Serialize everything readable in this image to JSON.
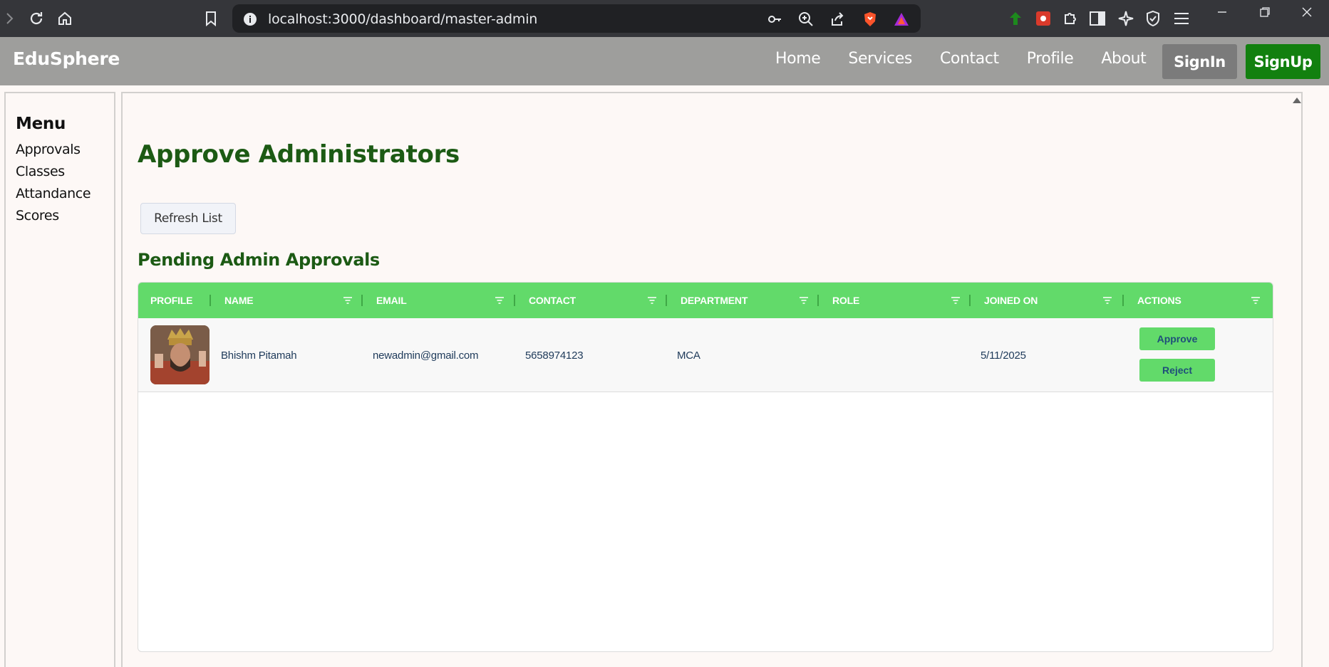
{
  "browser": {
    "url": "localhost:3000/dashboard/master-admin"
  },
  "navbar": {
    "brand": "EduSphere",
    "links": [
      "Home",
      "Services",
      "Contact",
      "Profile",
      "About"
    ],
    "signin_label": "SignIn",
    "signup_label": "SignUp",
    "signup_color": "#12800f"
  },
  "sidebar": {
    "title": "Menu",
    "items": [
      "Approvals",
      "Classes",
      "Attandance",
      "Scores"
    ]
  },
  "main": {
    "title": "Approve Administrators",
    "refresh_label": "Refresh List",
    "section_title": "Pending Admin Approvals",
    "accent_color": "#1c5a14",
    "header_color": "#62da6a",
    "columns": [
      "PROFILE",
      "NAME",
      "EMAIL",
      "CONTACT",
      "DEPARTMENT",
      "ROLE",
      "JOINED ON",
      "ACTIONS"
    ],
    "rows": [
      {
        "name": "Bhishm Pitamah",
        "email": "newadmin@gmail.com",
        "contact": "5658974123",
        "department": "MCA",
        "role": "",
        "joined_on": "5/11/2025",
        "approve_label": "Approve",
        "reject_label": "Reject"
      }
    ]
  }
}
